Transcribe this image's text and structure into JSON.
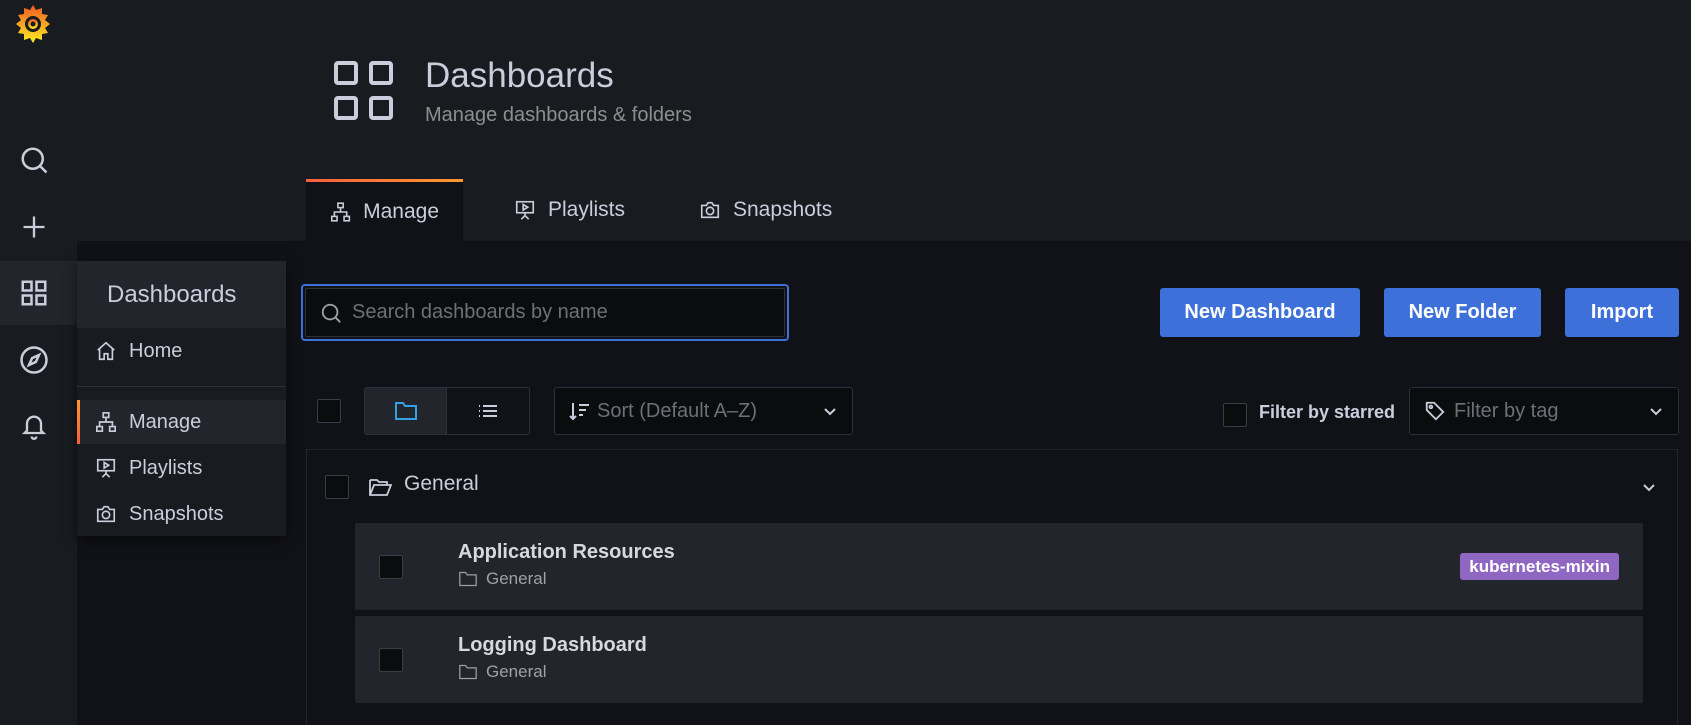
{
  "sidemenu": {
    "items": [
      "search-icon",
      "plus-icon",
      "dashboards-icon",
      "compass-icon",
      "bell-icon"
    ]
  },
  "flyout": {
    "title": "Dashboards",
    "items": [
      {
        "label": "Home",
        "icon": "home-icon"
      },
      {
        "label": "Manage",
        "icon": "sitemap-icon",
        "active": true
      },
      {
        "label": "Playlists",
        "icon": "presentation-icon"
      },
      {
        "label": "Snapshots",
        "icon": "camera-icon"
      }
    ]
  },
  "header": {
    "title": "Dashboards",
    "subtitle": "Manage dashboards & folders",
    "tabs": [
      {
        "label": "Manage",
        "icon": "sitemap-icon",
        "active": true
      },
      {
        "label": "Playlists",
        "icon": "presentation-icon"
      },
      {
        "label": "Snapshots",
        "icon": "camera-icon"
      }
    ]
  },
  "toolbar": {
    "search_placeholder": "Search dashboards by name",
    "new_dashboard": "New Dashboard",
    "new_folder": "New Folder",
    "import": "Import",
    "sort_placeholder": "Sort (Default A–Z)",
    "filter_starred": "Filter by starred",
    "filter_tag_placeholder": "Filter by tag"
  },
  "colors": {
    "primary": "#3d71d9",
    "tag": "#8f67c3",
    "accent": "#ff9830"
  },
  "list": {
    "folder": "General",
    "items": [
      {
        "title": "Application Resources",
        "folder": "General",
        "tags": [
          "kubernetes-mixin"
        ]
      },
      {
        "title": "Logging Dashboard",
        "folder": "General",
        "tags": []
      }
    ]
  }
}
